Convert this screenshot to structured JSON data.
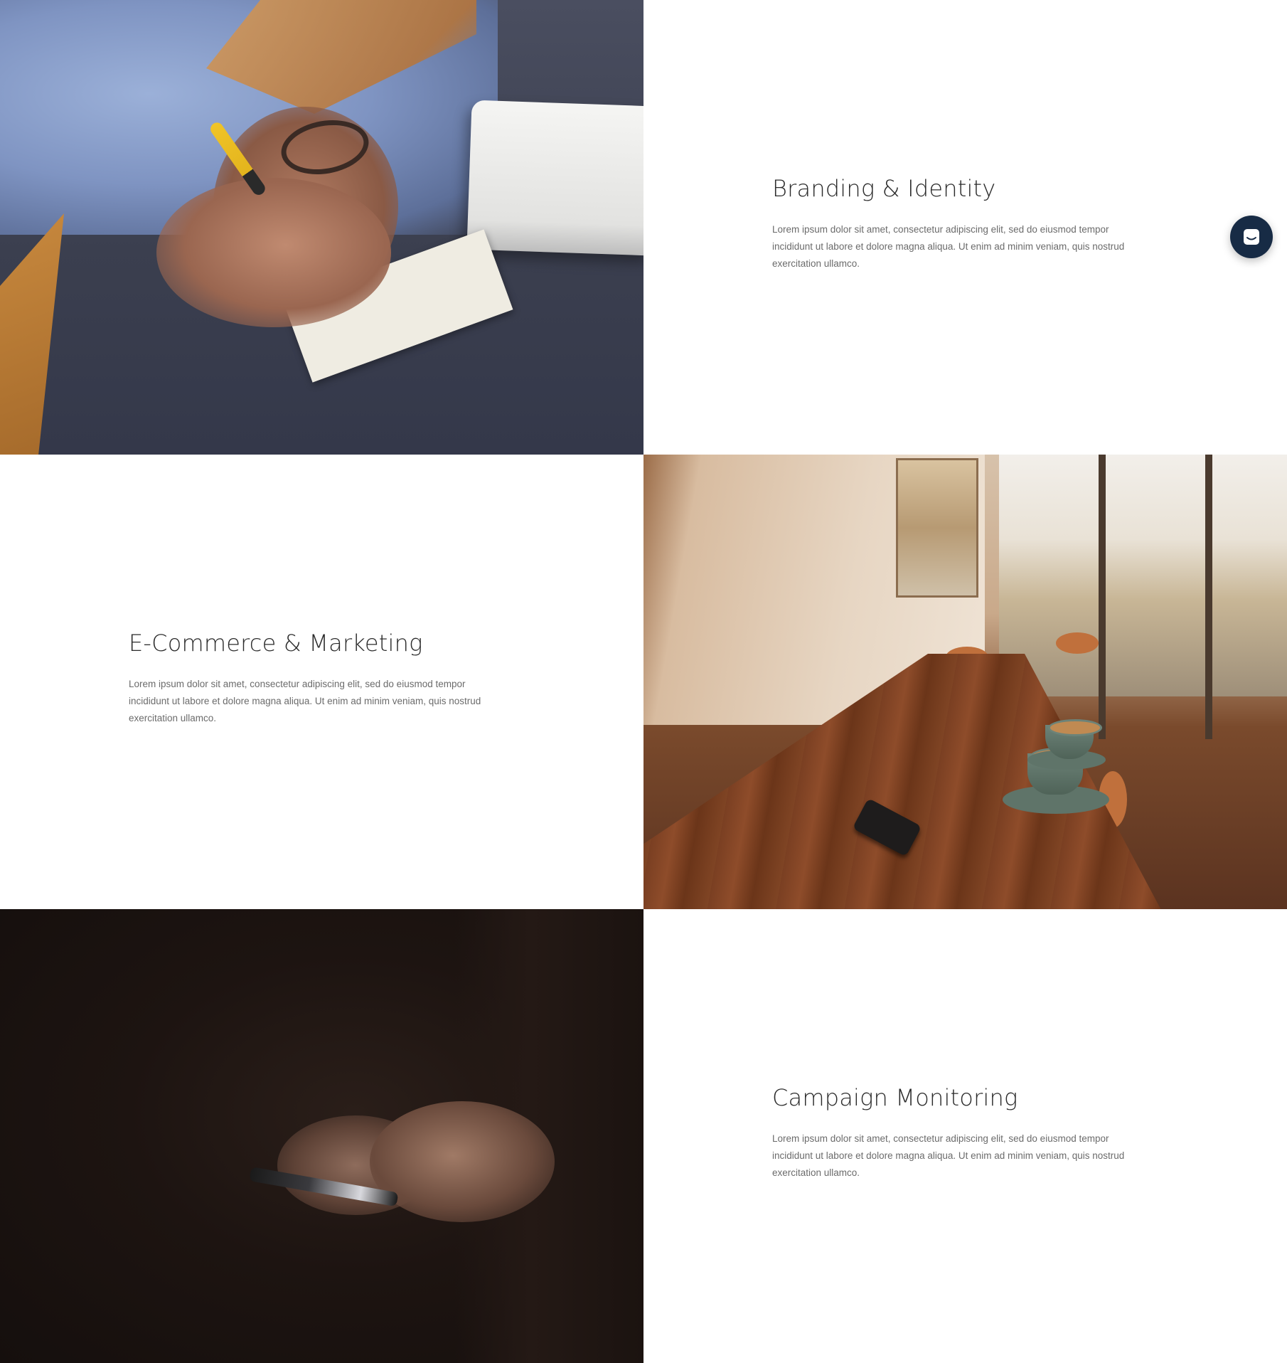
{
  "services": [
    {
      "title": "Branding & Identity",
      "description": "Lorem ipsum dolor sit amet, consectetur adipiscing elit, sed do eiusmod tempor incididunt ut labore et dolore magna aliqua. Ut enim ad minim veniam, quis nostrud exercitation ullamco.",
      "image": "man-writing-photo"
    },
    {
      "title": "E-Commerce & Marketing",
      "description": "Lorem ipsum dolor sit amet, consectetur adipiscing elit, sed do eiusmod tempor incididunt ut labore et dolore magna aliqua. Ut enim ad minim veniam, quis nostrud exercitation ullamco.",
      "image": "cafe-table-photo"
    },
    {
      "title": "Campaign Monitoring",
      "description": "Lorem ipsum dolor sit amet, consectetur adipiscing elit, sed do eiusmod tempor incididunt ut labore et dolore magna aliqua. Ut enim ad minim veniam, quis nostrud exercitation ullamco.",
      "image": "phone-in-hands-photo"
    }
  ],
  "chat_launcher": {
    "icon": "chat-icon",
    "color": "#172b45"
  }
}
